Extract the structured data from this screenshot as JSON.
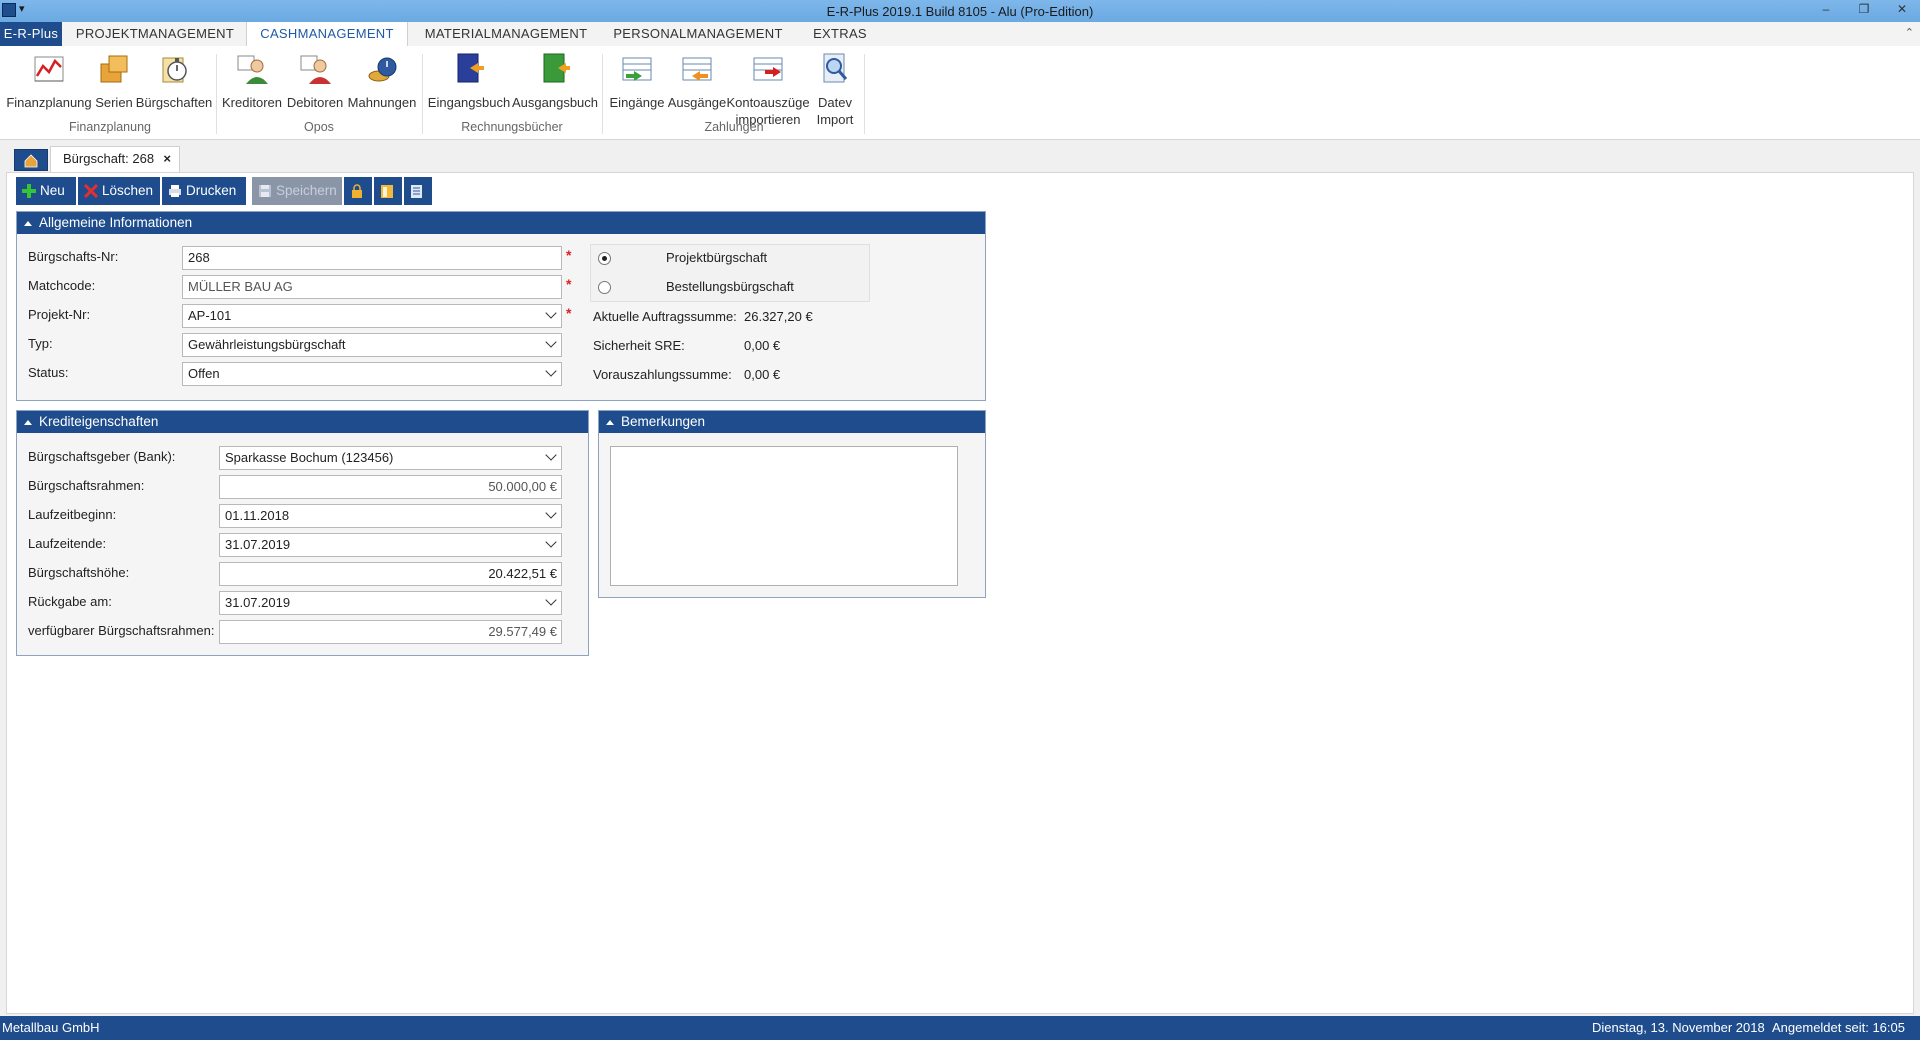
{
  "window": {
    "title": "E-R-Plus 2019.1 Build 8105 -  Alu (Pro-Edition)",
    "minimize": "–",
    "restore": "❐",
    "close": "✕"
  },
  "ribbon_tabs": {
    "app": "E-R-Plus",
    "items": [
      "PROJEKTMANAGEMENT",
      "CASHMANAGEMENT",
      "MATERIALMANAGEMENT",
      "PERSONALMANAGEMENT",
      "EXTRAS"
    ],
    "active": "CASHMANAGEMENT"
  },
  "ribbon": {
    "groups": {
      "finanzplanung": "Finanzplanung",
      "opos": "Opos",
      "rechnungsbuecher": "Rechnungsbücher",
      "zahlungen": "Zahlungen"
    },
    "buttons": {
      "finanzplanung": "Finanzplanung",
      "serien": "Serien",
      "buergschaften": "Bürgschaften",
      "kreditoren": "Kreditoren",
      "debitoren": "Debitoren",
      "mahnungen": "Mahnungen",
      "eingangsbuch": "Eingangsbuch",
      "ausgangsbuch": "Ausgangsbuch",
      "eingaenge": "Eingänge",
      "ausgaenge": "Ausgänge",
      "kontoauszuege_1": "Kontoauszüge",
      "kontoauszuege_2": "importieren",
      "datev_1": "Datev",
      "datev_2": "Import"
    }
  },
  "doc_tab": {
    "label": "Bürgschaft: 268",
    "close": "×"
  },
  "toolbar": {
    "neu": "Neu",
    "loeschen": "Löschen",
    "drucken": "Drucken",
    "speichern": "Speichern"
  },
  "allgemein": {
    "header": "Allgemeine Informationen",
    "buergschafts_nr_label": "Bürgschafts-Nr:",
    "buergschafts_nr": "268",
    "matchcode_label": "Matchcode:",
    "matchcode": "MÜLLER BAU AG",
    "projekt_nr_label": "Projekt-Nr:",
    "projekt_nr": "AP-101",
    "typ_label": "Typ:",
    "typ": "Gewährleistungsbürgschaft",
    "status_label": "Status:",
    "status": "Offen",
    "required_mark": "*",
    "radio_projekt": "Projektbürgschaft",
    "radio_bestellung": "Bestellungsbürgschaft",
    "auftragssumme_label": "Aktuelle Auftragssumme:",
    "auftragssumme": "26.327,20 €",
    "sicherheit_label": "Sicherheit SRE:",
    "sicherheit": "0,00 €",
    "vorauszahlung_label": "Vorauszahlungssumme:",
    "vorauszahlung": "0,00 €"
  },
  "kredit": {
    "header": "Krediteigenschaften",
    "geber_label": "Bürgschaftsgeber (Bank):",
    "geber": "Sparkasse Bochum (123456)",
    "rahmen_label": "Bürgschaftsrahmen:",
    "rahmen": "50.000,00 €",
    "beginn_label": "Laufzeitbeginn:",
    "beginn": "01.11.2018",
    "ende_label": "Laufzeitende:",
    "ende": "31.07.2019",
    "hoehe_label": "Bürgschaftshöhe:",
    "hoehe": "20.422,51 €",
    "rueckgabe_label": "Rückgabe am:",
    "rueckgabe": "31.07.2019",
    "verfuegbar_label": "verfügbarer Bürgschaftsrahmen:",
    "verfuegbar": "29.577,49 €"
  },
  "bemerkungen": {
    "header": "Bemerkungen",
    "text": ""
  },
  "status_bar": {
    "company": "Metallbau GmbH",
    "date": "Dienstag, 13. November 2018",
    "login": "Angemeldet seit: 16:05"
  }
}
